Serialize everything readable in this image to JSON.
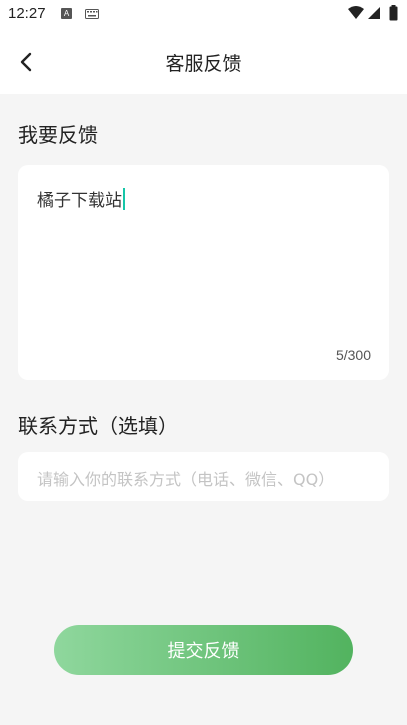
{
  "status_bar": {
    "time": "12:27",
    "icons": [
      "a-notification-icon",
      "keyboard-icon",
      "wifi-icon",
      "signal-icon",
      "battery-icon"
    ]
  },
  "header": {
    "title": "客服反馈",
    "back_icon": "chevron-left-icon"
  },
  "feedback": {
    "section_title": "我要反馈",
    "value": "橘子下载站",
    "counter": "5/300"
  },
  "contact": {
    "section_title": "联系方式（选填）",
    "placeholder": "请输入你的联系方式（电话、微信、QQ）"
  },
  "submit": {
    "label": "提交反馈"
  },
  "colors": {
    "accent_start": "#8fd79d",
    "accent_end": "#52b35f",
    "caret": "#16c6a8",
    "background": "#f5f5f5"
  }
}
